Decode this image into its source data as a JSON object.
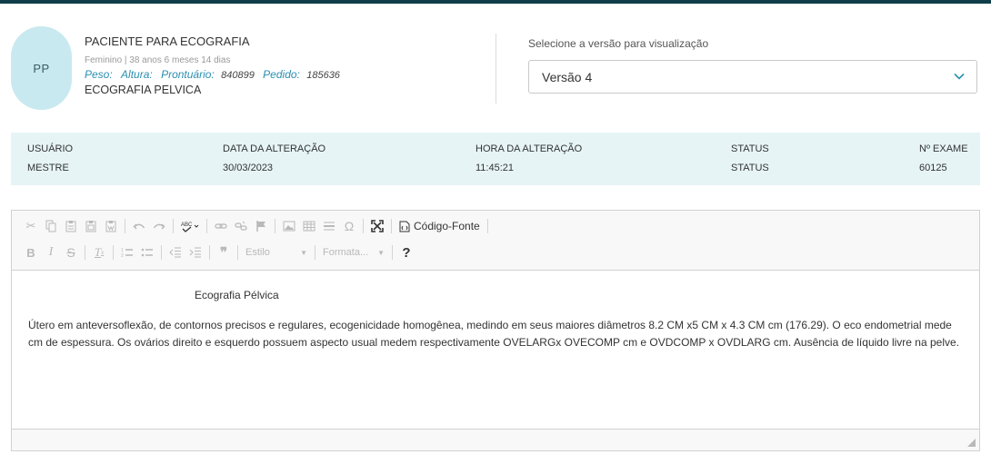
{
  "patient": {
    "initials": "PP",
    "name": "PACIENTE PARA ECOGRAFIA",
    "demographics": "Feminino | 38 anos 6 meses 14 dias",
    "peso_label": "Peso:",
    "altura_label": "Altura:",
    "prontuario_label": "Prontuário:",
    "prontuario_value": "840899",
    "pedido_label": "Pedido:",
    "pedido_value": "185636",
    "exam": "ECOGRAFIA PELVICA"
  },
  "version": {
    "label": "Selecione a versão para visualização",
    "selected": "Versão 4"
  },
  "info": {
    "headers": [
      "USUÁRIO",
      "DATA DA ALTERAÇÃO",
      "HORA DA ALTERAÇÃO",
      "STATUS",
      "Nº EXAME"
    ],
    "values": [
      "MESTRE",
      "30/03/2023",
      "11:45:21",
      "STATUS",
      "60125"
    ]
  },
  "toolbar": {
    "source_label": "Código-Fonte",
    "style_label": "Estilo",
    "format_label": "Formata..."
  },
  "content": {
    "title": "Ecografia Pélvica",
    "body": "Útero em anteversoflexão, de contornos precisos e regulares, ecogenicidade homogênea, medindo em seus maiores diâmetros 8.2 CM x5 CM  x 4.3 CM cm (176.29). O eco endometrial mede  cm de espessura. Os ovários direito e esquerdo possuem aspecto usual medem respectivamente OVELARGx OVECOMP cm e OVDCOMP x OVDLARG cm. Ausência de líquido livre na pelve."
  },
  "colors": {
    "accent": "#2a8fb0",
    "strip_bg": "#e6f4f6",
    "avatar_bg": "#c8e9ef",
    "topbar": "#0f3d4a"
  },
  "icons": [
    "cut-icon",
    "copy-icon",
    "paste-icon",
    "paste-text-icon",
    "paste-word-icon",
    "undo-icon",
    "redo-icon",
    "spellcheck-icon",
    "link-icon",
    "unlink-icon",
    "anchor-icon",
    "image-icon",
    "table-icon",
    "horizontal-rule-icon",
    "special-char-icon",
    "maximize-icon",
    "source-icon",
    "bold-icon",
    "italic-icon",
    "strike-icon",
    "remove-format-icon",
    "numbered-list-icon",
    "bulleted-list-icon",
    "outdent-icon",
    "indent-icon",
    "blockquote-icon",
    "help-icon"
  ]
}
